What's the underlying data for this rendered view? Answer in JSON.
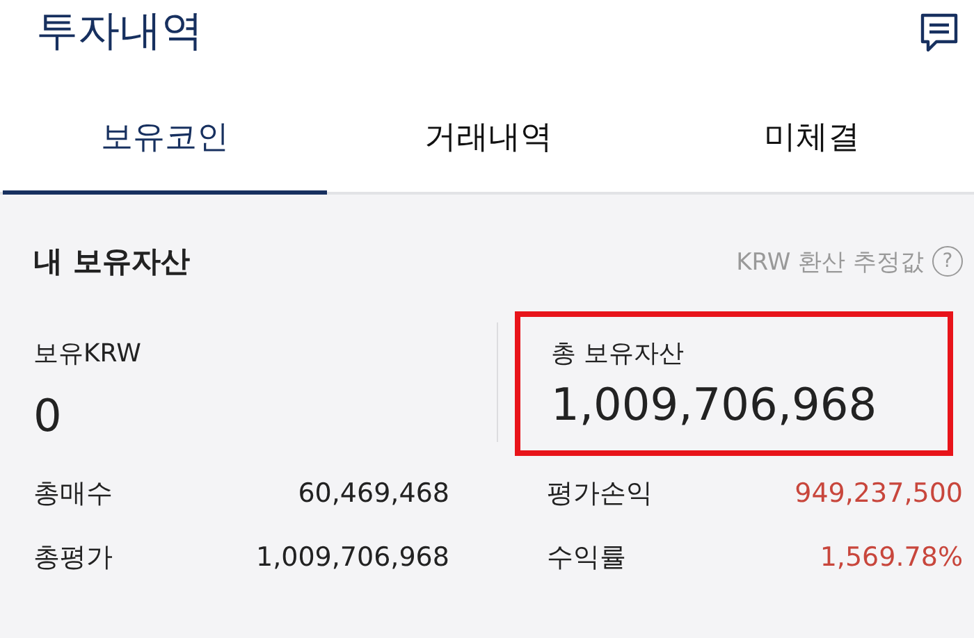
{
  "header": {
    "title": "투자내역"
  },
  "tabs": [
    {
      "label": "보유코인",
      "selected": true
    },
    {
      "label": "거래내역",
      "selected": false
    },
    {
      "label": "미체결",
      "selected": false
    }
  ],
  "assets": {
    "title": "내 보유자산",
    "note": "KRW 환산 추정값",
    "help": "?",
    "krw": {
      "label": "보유KRW",
      "value": "0"
    },
    "total": {
      "label": "총 보유자산",
      "value": "1,009,706,968",
      "highlighted": true
    },
    "stats": [
      {
        "label": "총매수",
        "value": "60,469,468",
        "color": "#222222"
      },
      {
        "label": "평가손익",
        "value": "949,237,500",
        "color": "#c8463c"
      },
      {
        "label": "총평가",
        "value": "1,009,706,968",
        "color": "#222222"
      },
      {
        "label": "수익률",
        "value": "1,569.78%",
        "color": "#c8463c"
      }
    ]
  }
}
